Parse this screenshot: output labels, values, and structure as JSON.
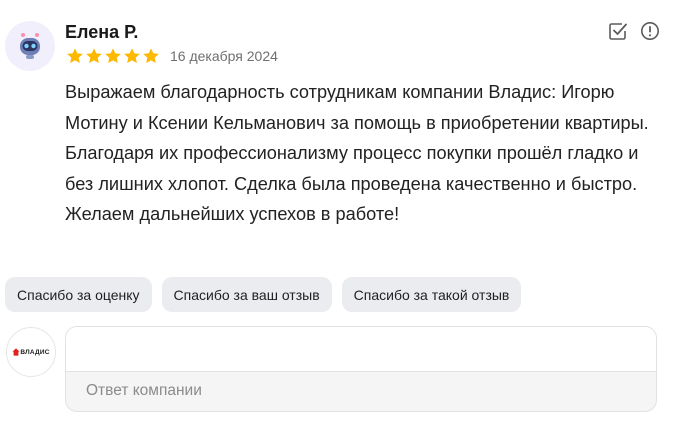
{
  "review": {
    "author": "Елена Р.",
    "rating": 5,
    "date": "16 декабря 2024",
    "text": "Выражаем благодарность сотрудникам компании Владис: Игорю Мотину и Ксении Кельманович за помощь в приобретении квартиры. Благодаря их профессионализму процесс покупки прошёл гладко и без лишних хлопот. Сделка была проведена качественно и быстро. Желаем дальнейших успехов в работе!"
  },
  "icons": {
    "edit": "edit-check-icon",
    "report": "info-circle-icon",
    "star": "star-icon"
  },
  "colors": {
    "star": "#fcb900",
    "chip_bg": "#ebecef",
    "logo_red": "#e0231f"
  },
  "quick_replies": [
    "Спасибо за оценку",
    "Спасибо за ваш отзыв",
    "Спасибо за такой отзыв"
  ],
  "company": {
    "logo_text": "ВЛАДИС",
    "reply_placeholder": "Ответ компании"
  }
}
